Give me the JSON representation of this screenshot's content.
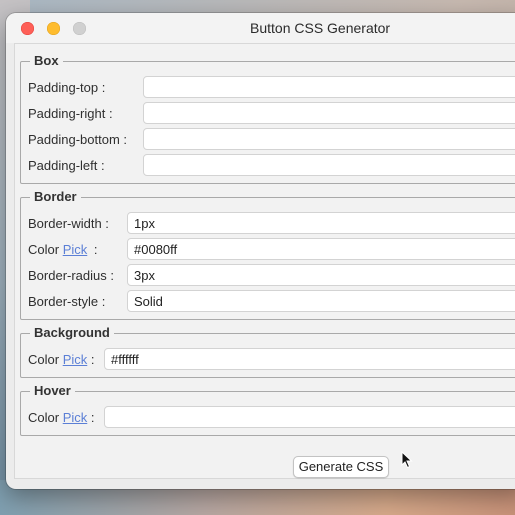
{
  "window": {
    "title": "Button CSS Generator"
  },
  "box": {
    "legend": "Box",
    "fields": [
      {
        "label": "Padding-top :",
        "value": ""
      },
      {
        "label": "Padding-right :",
        "value": ""
      },
      {
        "label": "Padding-bottom :",
        "value": ""
      },
      {
        "label": "Padding-left :",
        "value": ""
      }
    ]
  },
  "border": {
    "legend": "Border",
    "width": {
      "label": "Border-width :",
      "value": "1px"
    },
    "color": {
      "label_prefix": "Color",
      "pick": "Pick",
      "label_suffix": ":",
      "value": "#0080ff"
    },
    "radius": {
      "label": "Border-radius :",
      "value": "3px"
    },
    "style": {
      "label": "Border-style :",
      "value": "Solid"
    }
  },
  "background": {
    "legend": "Background",
    "color": {
      "label_prefix": "Color",
      "pick": "Pick",
      "label_suffix": ":",
      "value": "#ffffff"
    }
  },
  "hover": {
    "legend": "Hover",
    "color": {
      "label_prefix": "Color",
      "pick": "Pick",
      "label_suffix": ":",
      "value": ""
    }
  },
  "actions": {
    "generate_label": "Generate CSS"
  }
}
